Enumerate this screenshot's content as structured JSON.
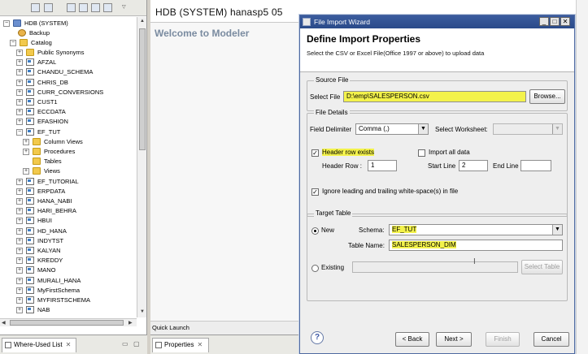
{
  "editor": {
    "title": "HDB (SYSTEM)  hanasp5 05",
    "welcome": "Welcome to Modeler",
    "quick_launch": "Quick Launch"
  },
  "left_toolbar": {
    "icons": [
      "link-icon",
      "collapse-icon",
      "filter-icon",
      "refresh-icon",
      "add-system-icon",
      "view-menu-icon"
    ]
  },
  "tree": {
    "root": "HDB (SYSTEM)",
    "backup": "Backup",
    "catalog": "Catalog",
    "schemas": [
      "Public Synonyms",
      "AFZAL",
      "CHANDU_SCHEMA",
      "CHRIS_DB",
      "CURR_CONVERSIONS",
      "CUST1",
      "ECCDATA",
      "EFASHION",
      "EF_TUT"
    ],
    "ef_tut_children": [
      "Column Views",
      "Procedures",
      "Tables",
      "Views"
    ],
    "more_schemas": [
      "EF_TUTORIAL",
      "ERPDATA",
      "HANA_NABI",
      "HARI_BEHRA",
      "HBUI",
      "HD_HANA",
      "INDYTST",
      "KALYAN",
      "KREDDY",
      "MANO",
      "MURALI_HANA",
      "MyFirstSchema",
      "MYFIRSTSCHEMA",
      "NAB"
    ]
  },
  "bottom_tabs": {
    "where_used": "Where-Used List",
    "properties": "Properties"
  },
  "dialog": {
    "window_title": "File Import Wizard",
    "heading": "Define Import Properties",
    "subtitle": "Select the CSV or Excel File(Office 1997 or above) to upload data",
    "source_file": {
      "group": "Source File",
      "label": "Select File",
      "value": "D:\\emp\\SALESPERSON.csv",
      "browse": "Browse..."
    },
    "file_details": {
      "group": "File Details",
      "delimiter_label": "Field Delimiter",
      "delimiter_value": "Comma (,)",
      "worksheet_label": "Select Worksheet:",
      "worksheet_value": "",
      "header_row_exists": "Header row exists",
      "header_row_exists_checked": true,
      "import_all": "Import all data",
      "import_all_checked": false,
      "header_row_label": "Header Row :",
      "header_row_value": "1",
      "start_line_label": "Start Line",
      "start_line_value": "2",
      "end_line_label": "End Line",
      "end_line_value": "",
      "ignore_whitespace": "Ignore leading and trailing white-space(s) in file",
      "ignore_whitespace_checked": true
    },
    "target_table": {
      "group": "Target Table",
      "new_label": "New",
      "new_selected": true,
      "schema_label": "Schema:",
      "schema_value": "EF_TUT",
      "table_name_label": "Table Name:",
      "table_name_value": "SALESPERSON_DIM",
      "existing_label": "Existing",
      "existing_selected": false,
      "existing_value": "",
      "select_table": "Select Table"
    },
    "buttons": {
      "help": "?",
      "back": "< Back",
      "next": "Next >",
      "finish": "Finish",
      "cancel": "Cancel"
    }
  },
  "colors": {
    "highlight": "#f3f24b",
    "dialog_title": "#2f4f8f",
    "welcome_text": "#7a8ba0"
  }
}
